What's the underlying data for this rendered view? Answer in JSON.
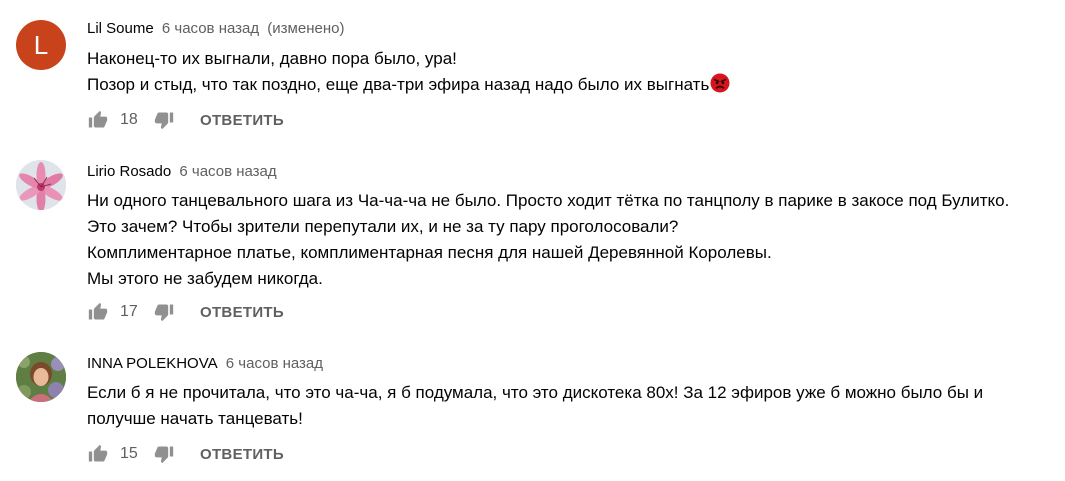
{
  "comments": [
    {
      "author": "Lil Soume",
      "time": "6 часов назад",
      "edited": "(изменено)",
      "avatar_letter": "L",
      "avatar_color": "#c8431b",
      "lines": [
        "Наконец-то их выгнали, давно пора было, ура!",
        "Позор и стыд, что так поздно, еще два-три эфира назад надо было их выгнать"
      ],
      "likes": "18",
      "reply": "ОТВЕТИТЬ"
    },
    {
      "author": "Lirio Rosado",
      "time": "6 часов назад",
      "lines": [
        "Ни одного танцевального шага из Ча-ча-ча не было. Просто ходит тётка по танцполу в парике в закосе под Булитко.",
        "Это зачем? Чтобы зрители перепутали их, и не за ту пару проголосовали?",
        "Комплиментарное платье, комплиментарная песня для нашей Деревянной Королевы.",
        "Мы этого не забудем никогда."
      ],
      "likes": "17",
      "reply": "ОТВЕТИТЬ"
    },
    {
      "author": "INNA POLEKHOVA",
      "time": "6 часов назад",
      "lines": [
        "Если б я не прочитала, что это ча-ча, я б подумала, что это дискотека 80х! За 12 эфиров уже б можно было бы и",
        "получше начать танцевать!"
      ],
      "likes": "15",
      "reply": "ОТВЕТИТЬ"
    }
  ],
  "icons": {
    "like": "thumb-up-icon",
    "dislike": "thumb-down-icon",
    "emoji": "angry-face-emoji"
  }
}
